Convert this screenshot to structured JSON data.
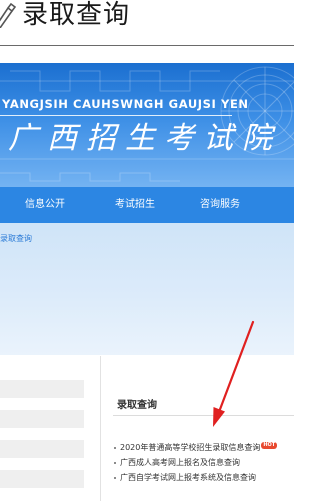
{
  "caption": {
    "icon": "brush-icon",
    "title": "录取查询"
  },
  "banner": {
    "english_name": "YANGJSIH CAUHSWNGH GAUJSI YEN",
    "chinese_name": "广西招生考试院",
    "colors": {
      "top": "#1b6fd0",
      "bottom": "#74b3f2"
    }
  },
  "nav": {
    "items": [
      {
        "label": "信息公开"
      },
      {
        "label": "考试招生"
      },
      {
        "label": "咨询服务"
      }
    ],
    "color": "#2c86e3"
  },
  "breadcrumb": {
    "text": "录取查询"
  },
  "panel": {
    "title": "录取查询",
    "items": [
      {
        "label": "2020年普通高等学校招生录取信息查询",
        "badge": "HOT"
      },
      {
        "label": "广西成人高考网上报名及信息查询"
      },
      {
        "label": "广西自学考试网上报考系统及信息查询"
      }
    ]
  },
  "annotation": {
    "arrow_color": "#e02020",
    "icon": "red-arrow-icon"
  }
}
